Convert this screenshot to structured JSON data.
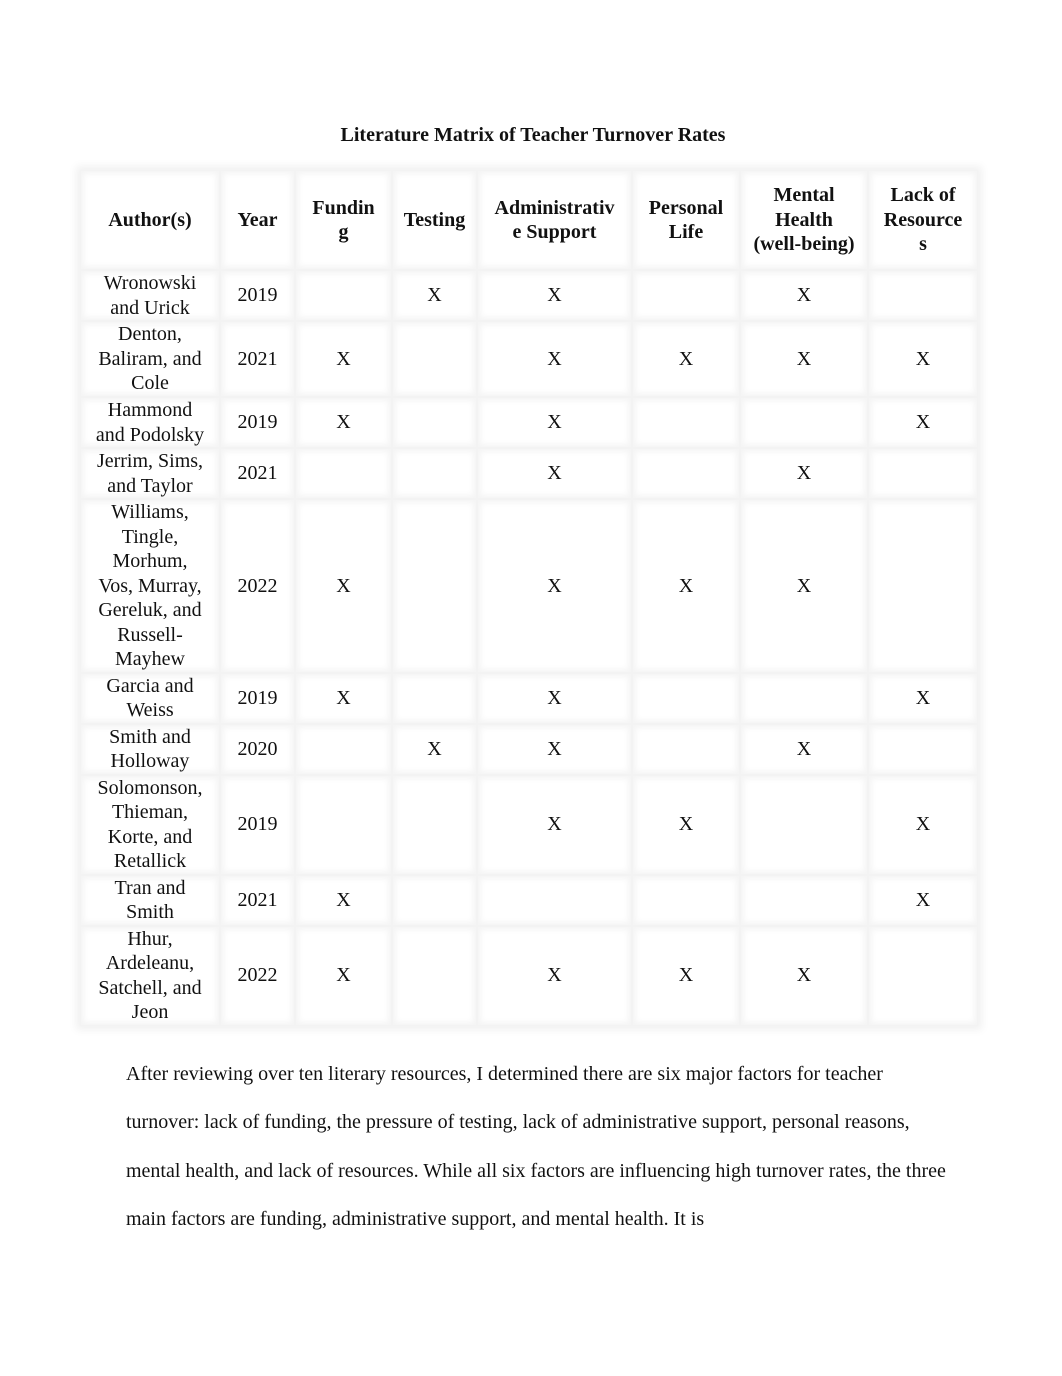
{
  "document": {
    "title": "Literature Matrix of Teacher Turnover Rates",
    "table": {
      "headers": [
        "Author(s)",
        "Year",
        "Fundin g",
        "Testing",
        "Administrativ e Support",
        "Personal Life",
        "Mental Health (well-being)",
        "Lack of Resource s"
      ],
      "header_lines": [
        [
          "Author(s)"
        ],
        [
          "Year"
        ],
        [
          "Fundin",
          "g"
        ],
        [
          "Testing"
        ],
        [
          "Administrativ",
          "e Support"
        ],
        [
          "Personal",
          "Life"
        ],
        [
          "Mental",
          "Health",
          "(well-being)"
        ],
        [
          "Lack of",
          "Resource",
          "s"
        ]
      ],
      "rows": [
        {
          "authors": "Wronowski and Urick",
          "author_lines": [
            "Wronowski",
            "and Urick"
          ],
          "year": "2019",
          "funding": "",
          "testing": "X",
          "admin_support": "X",
          "personal_life": "",
          "mental_health": "X",
          "lack_resources": ""
        },
        {
          "authors": "Denton, Baliram, and Cole",
          "author_lines": [
            "Denton,",
            "Baliram, and",
            "Cole"
          ],
          "year": "2021",
          "funding": "X",
          "testing": "",
          "admin_support": "X",
          "personal_life": "X",
          "mental_health": "X",
          "lack_resources": "X"
        },
        {
          "authors": "Hammond and Podolsky",
          "author_lines": [
            "Hammond",
            "and Podolsky"
          ],
          "year": "2019",
          "funding": "X",
          "testing": "",
          "admin_support": "X",
          "personal_life": "",
          "mental_health": "",
          "lack_resources": "X"
        },
        {
          "authors": "Jerrim, Sims, and Taylor",
          "author_lines": [
            "Jerrim, Sims,",
            "and Taylor"
          ],
          "year": "2021",
          "funding": "",
          "testing": "",
          "admin_support": "X",
          "personal_life": "",
          "mental_health": "X",
          "lack_resources": ""
        },
        {
          "authors": "Williams, Tingle, Morhum, Vos, Murray, Gereluk, and Russell-Mayhew",
          "author_lines": [
            "Williams,",
            "Tingle,",
            "Morhum,",
            "Vos, Murray,",
            "Gereluk, and",
            "Russell-",
            "Mayhew"
          ],
          "year": "2022",
          "funding": "X",
          "testing": "",
          "admin_support": "X",
          "personal_life": "X",
          "mental_health": "X",
          "lack_resources": ""
        },
        {
          "authors": "Garcia and Weiss",
          "author_lines": [
            "Garcia and",
            "Weiss"
          ],
          "year": "2019",
          "funding": "X",
          "testing": "",
          "admin_support": "X",
          "personal_life": "",
          "mental_health": "",
          "lack_resources": "X"
        },
        {
          "authors": "Smith and Holloway",
          "author_lines": [
            "Smith and",
            "Holloway"
          ],
          "year": "2020",
          "funding": "",
          "testing": "X",
          "admin_support": "X",
          "personal_life": "",
          "mental_health": "X",
          "lack_resources": ""
        },
        {
          "authors": "Solomonson, Thieman, Korte, and Retallick",
          "author_lines": [
            "Solomonson,",
            "Thieman,",
            "Korte, and",
            "Retallick"
          ],
          "year": "2019",
          "funding": "",
          "testing": "",
          "admin_support": "X",
          "personal_life": "X",
          "mental_health": "",
          "lack_resources": "X"
        },
        {
          "authors": "Tran and Smith",
          "author_lines": [
            "Tran and",
            "Smith"
          ],
          "year": "2021",
          "funding": "X",
          "testing": "",
          "admin_support": "",
          "personal_life": "",
          "mental_health": "",
          "lack_resources": "X"
        },
        {
          "authors": "Hhur, Ardeleanu, Satchell, and Jeon",
          "author_lines": [
            "Hhur,",
            "Ardeleanu,",
            "Satchell, and",
            "Jeon"
          ],
          "year": "2022",
          "funding": "X",
          "testing": "",
          "admin_support": "X",
          "personal_life": "X",
          "mental_health": "X",
          "lack_resources": ""
        }
      ]
    },
    "paragraph": "After reviewing over ten literary resources, I determined there are six major factors for teacher turnover: lack of funding, the pressure of testing, lack of administrative support, personal reasons, mental health, and lack of resources. While all six factors are influencing high turnover rates, the three main factors are funding, administrative support, and mental health. It is"
  }
}
